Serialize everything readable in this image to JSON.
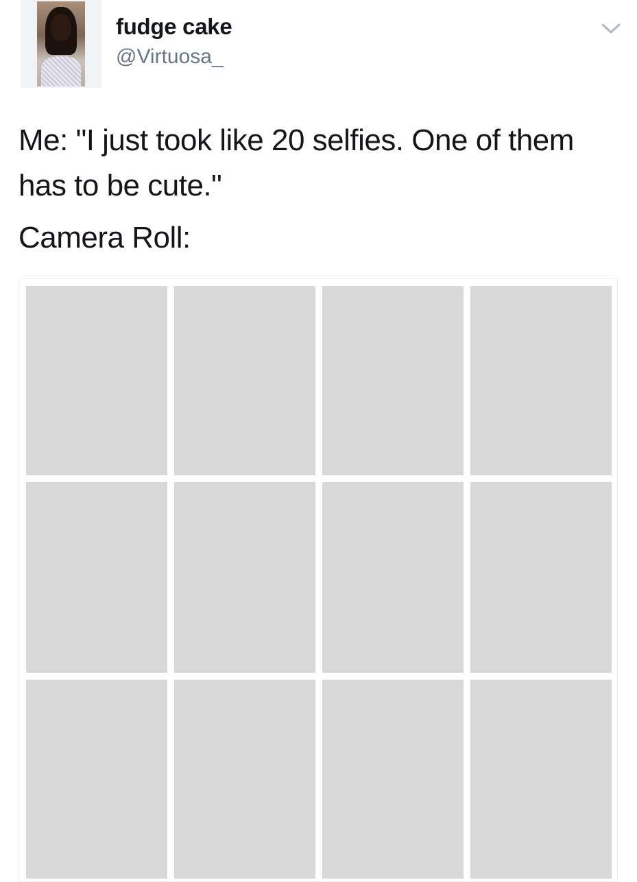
{
  "user": {
    "display_name": "fudge cake",
    "handle": "@Virtuosa_"
  },
  "tweet": {
    "text": "Me: \"I just took like 20 selfies. One of them has to be cute.\"",
    "caption": "Camera Roll:"
  },
  "icons": {
    "menu": "chevron-down-icon"
  },
  "media": {
    "tile_color": "#d8d8d8",
    "rows": 3,
    "columns": 4
  },
  "colors": {
    "text": "#14171a",
    "handle": "#657786",
    "chevron": "#aab8c2"
  }
}
